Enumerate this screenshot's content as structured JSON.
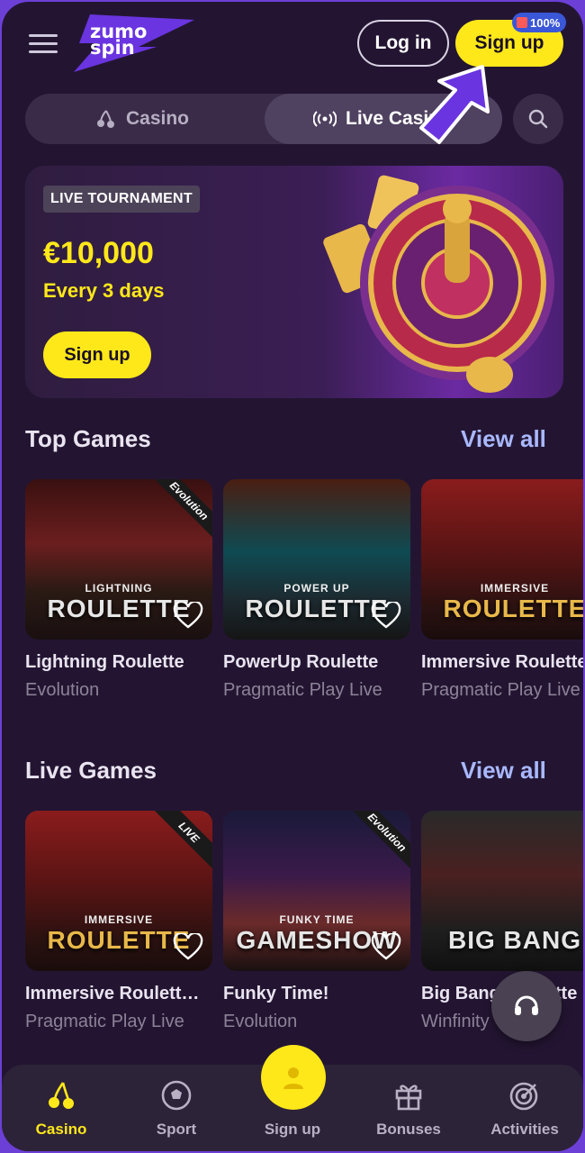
{
  "header": {
    "logo_line1": "zumo",
    "logo_line2": "spin",
    "login_label": "Log in",
    "signup_label": "Sign up",
    "badge_text": "100%"
  },
  "tabs": [
    {
      "label": "Casino",
      "icon": "cherries-icon"
    },
    {
      "label": "Live Casino",
      "icon": "live-broadcast-icon"
    }
  ],
  "banner": {
    "tag": "LIVE TOURNAMENT",
    "prize": "€10,000",
    "frequency": "Every 3 days",
    "cta": "Sign up"
  },
  "top_games": {
    "title": "Top Games",
    "view_all": "View all",
    "items": [
      {
        "name": "Lightning Roulette",
        "provider": "Evolution",
        "thumb_title": "ROULETTE",
        "thumb_sub": "LIGHTNING",
        "tag": "Evolution"
      },
      {
        "name": "PowerUp Roulette",
        "provider": "Pragmatic Play Live",
        "thumb_title": "ROULETTE",
        "thumb_sub": "POWER UP",
        "tag": ""
      },
      {
        "name": "Immersive Roulette Deluxe",
        "provider": "Pragmatic Play Live",
        "thumb_title": "ROULETTE",
        "thumb_sub": "IMMERSIVE",
        "tag": ""
      }
    ]
  },
  "live_games": {
    "title": "Live Games",
    "view_all": "View all",
    "items": [
      {
        "name": "Immersive Roulett…",
        "provider": "Pragmatic Play Live",
        "thumb_title": "ROULETTE",
        "thumb_sub": "IMMERSIVE",
        "tag": "LIVE"
      },
      {
        "name": "Funky Time!",
        "provider": "Evolution",
        "thumb_title": "GAMESHOW",
        "thumb_sub": "FUNKY TIME",
        "tag": "Evolution"
      },
      {
        "name": "Big Bang Roulette",
        "provider": "Winfinity",
        "thumb_title": "BIG BANG",
        "thumb_sub": "",
        "tag": ""
      }
    ]
  },
  "bottom_nav": [
    {
      "label": "Casino",
      "icon": "cherries-icon",
      "active": true
    },
    {
      "label": "Sport",
      "icon": "soccer-ball-icon",
      "active": false
    },
    {
      "label": "Sign up",
      "icon": "user-icon",
      "active": false
    },
    {
      "label": "Bonuses",
      "icon": "gift-icon",
      "active": false
    },
    {
      "label": "Activities",
      "icon": "target-icon",
      "active": false
    }
  ],
  "colors": {
    "accent_yellow": "#ffe81a",
    "background": "#231532",
    "link_blue": "#a9b8ff",
    "brand_purple": "#6c3fd6"
  }
}
